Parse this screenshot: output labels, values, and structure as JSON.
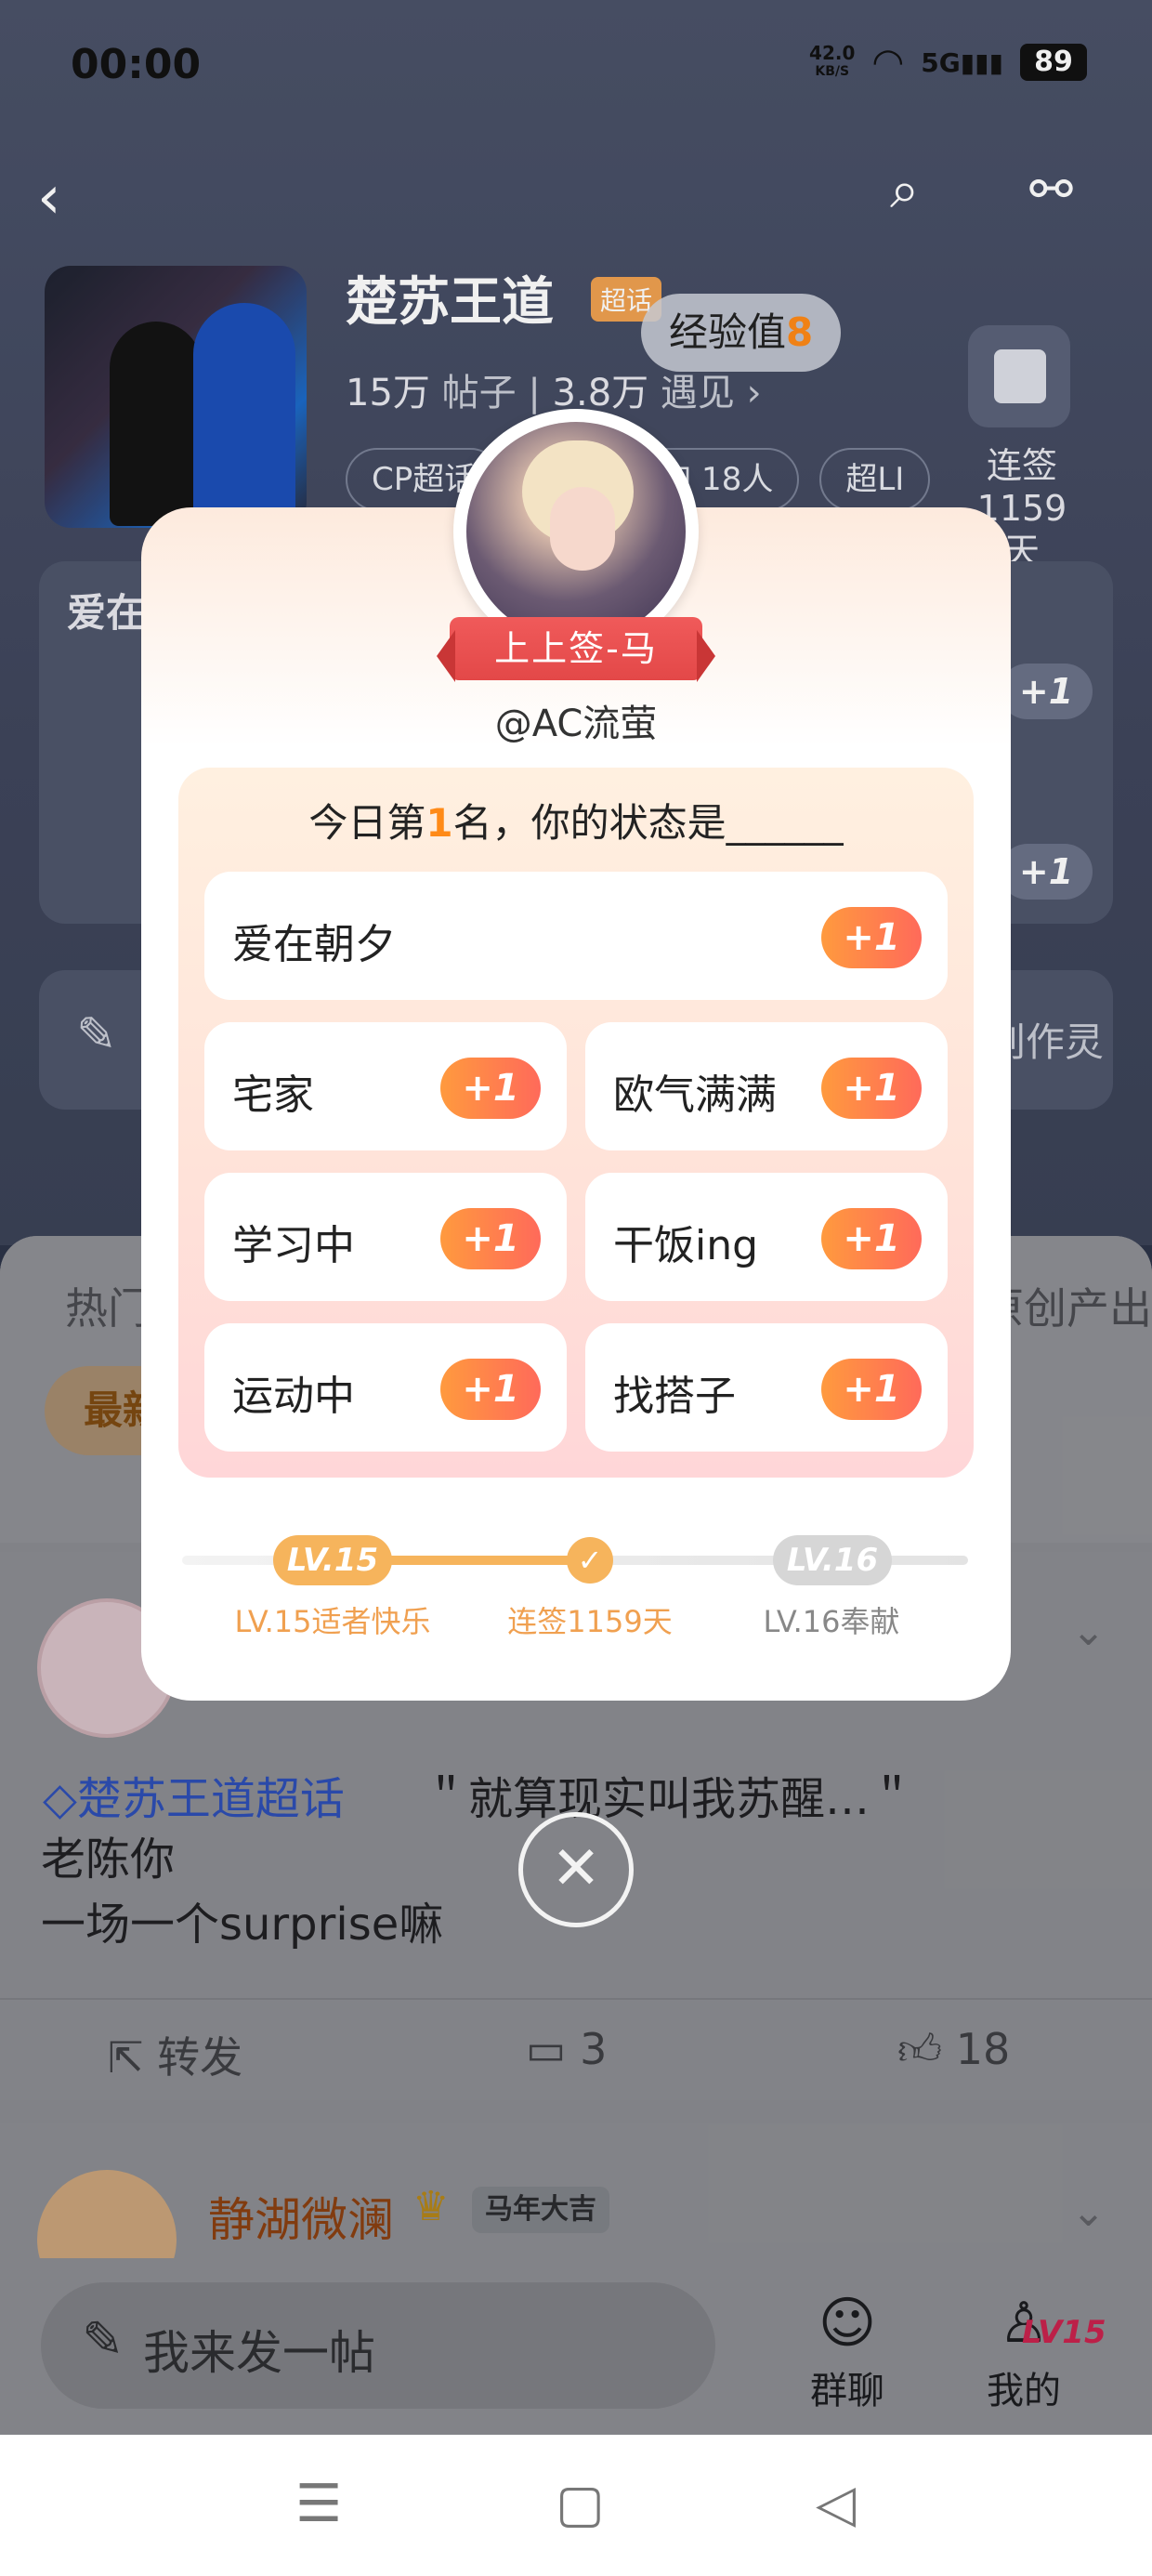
{
  "status": {
    "time": "00:00",
    "net_speed": "42.0",
    "net_unit": "KB/S",
    "signal": "5G",
    "battery": "89"
  },
  "topic": {
    "title": "楚苏王道",
    "tag": "超话",
    "posts": "15万",
    "posts_label": "帖子",
    "meets": "3.8万",
    "meets_label": "遇见 ›",
    "chips": [
      "CP超话",
      "加 18人",
      "超LI"
    ],
    "signin_label": "连签",
    "signin_days": "1159天"
  },
  "exp": {
    "label": "经验值",
    "value": "8"
  },
  "bg_cards": {
    "love_title": "爱在",
    "plus": "+1",
    "create_text": "创作灵"
  },
  "feed": {
    "tab_left": "热门",
    "tab_right": "原创产出",
    "latest": "最新",
    "post": {
      "tag": "楚苏王道超话",
      "quote": "＂就算现实叫我苏醒…＂",
      "body_line1": "老陈你",
      "body_line2": "一场一个surprise嘛",
      "repost": "转发",
      "comments": "3",
      "likes": "18"
    },
    "post2": {
      "name": "静湖微澜",
      "badge": "马年大吉"
    }
  },
  "bottom_bar": {
    "compose": "我来发一帖",
    "group_chat": "群聊",
    "mine": "我的",
    "level_badge": "LV15"
  },
  "modal": {
    "ribbon": "上上签-马",
    "username": "@AC流萤",
    "prompt_prefix": "今日第",
    "prompt_rank": "1",
    "prompt_suffix": "名，你的状态是______",
    "plus_label": "+1",
    "options": [
      "爱在朝夕",
      "宅家",
      "欧气满满",
      "学习中",
      "干饭ing",
      "运动中",
      "找搭子"
    ],
    "level": {
      "current_badge": "LV.15",
      "current_caption": "LV.15适者快乐",
      "streak_caption": "连签1159天",
      "next_badge": "LV.16",
      "next_caption": "LV.16奉献",
      "progress_fraction": 0.5
    }
  },
  "colors": {
    "accent_orange": "#ff8a17",
    "ribbon_red": "#e34848",
    "plus_gradient_start": "#ff9a3e",
    "plus_gradient_end": "#ff6a5a"
  }
}
